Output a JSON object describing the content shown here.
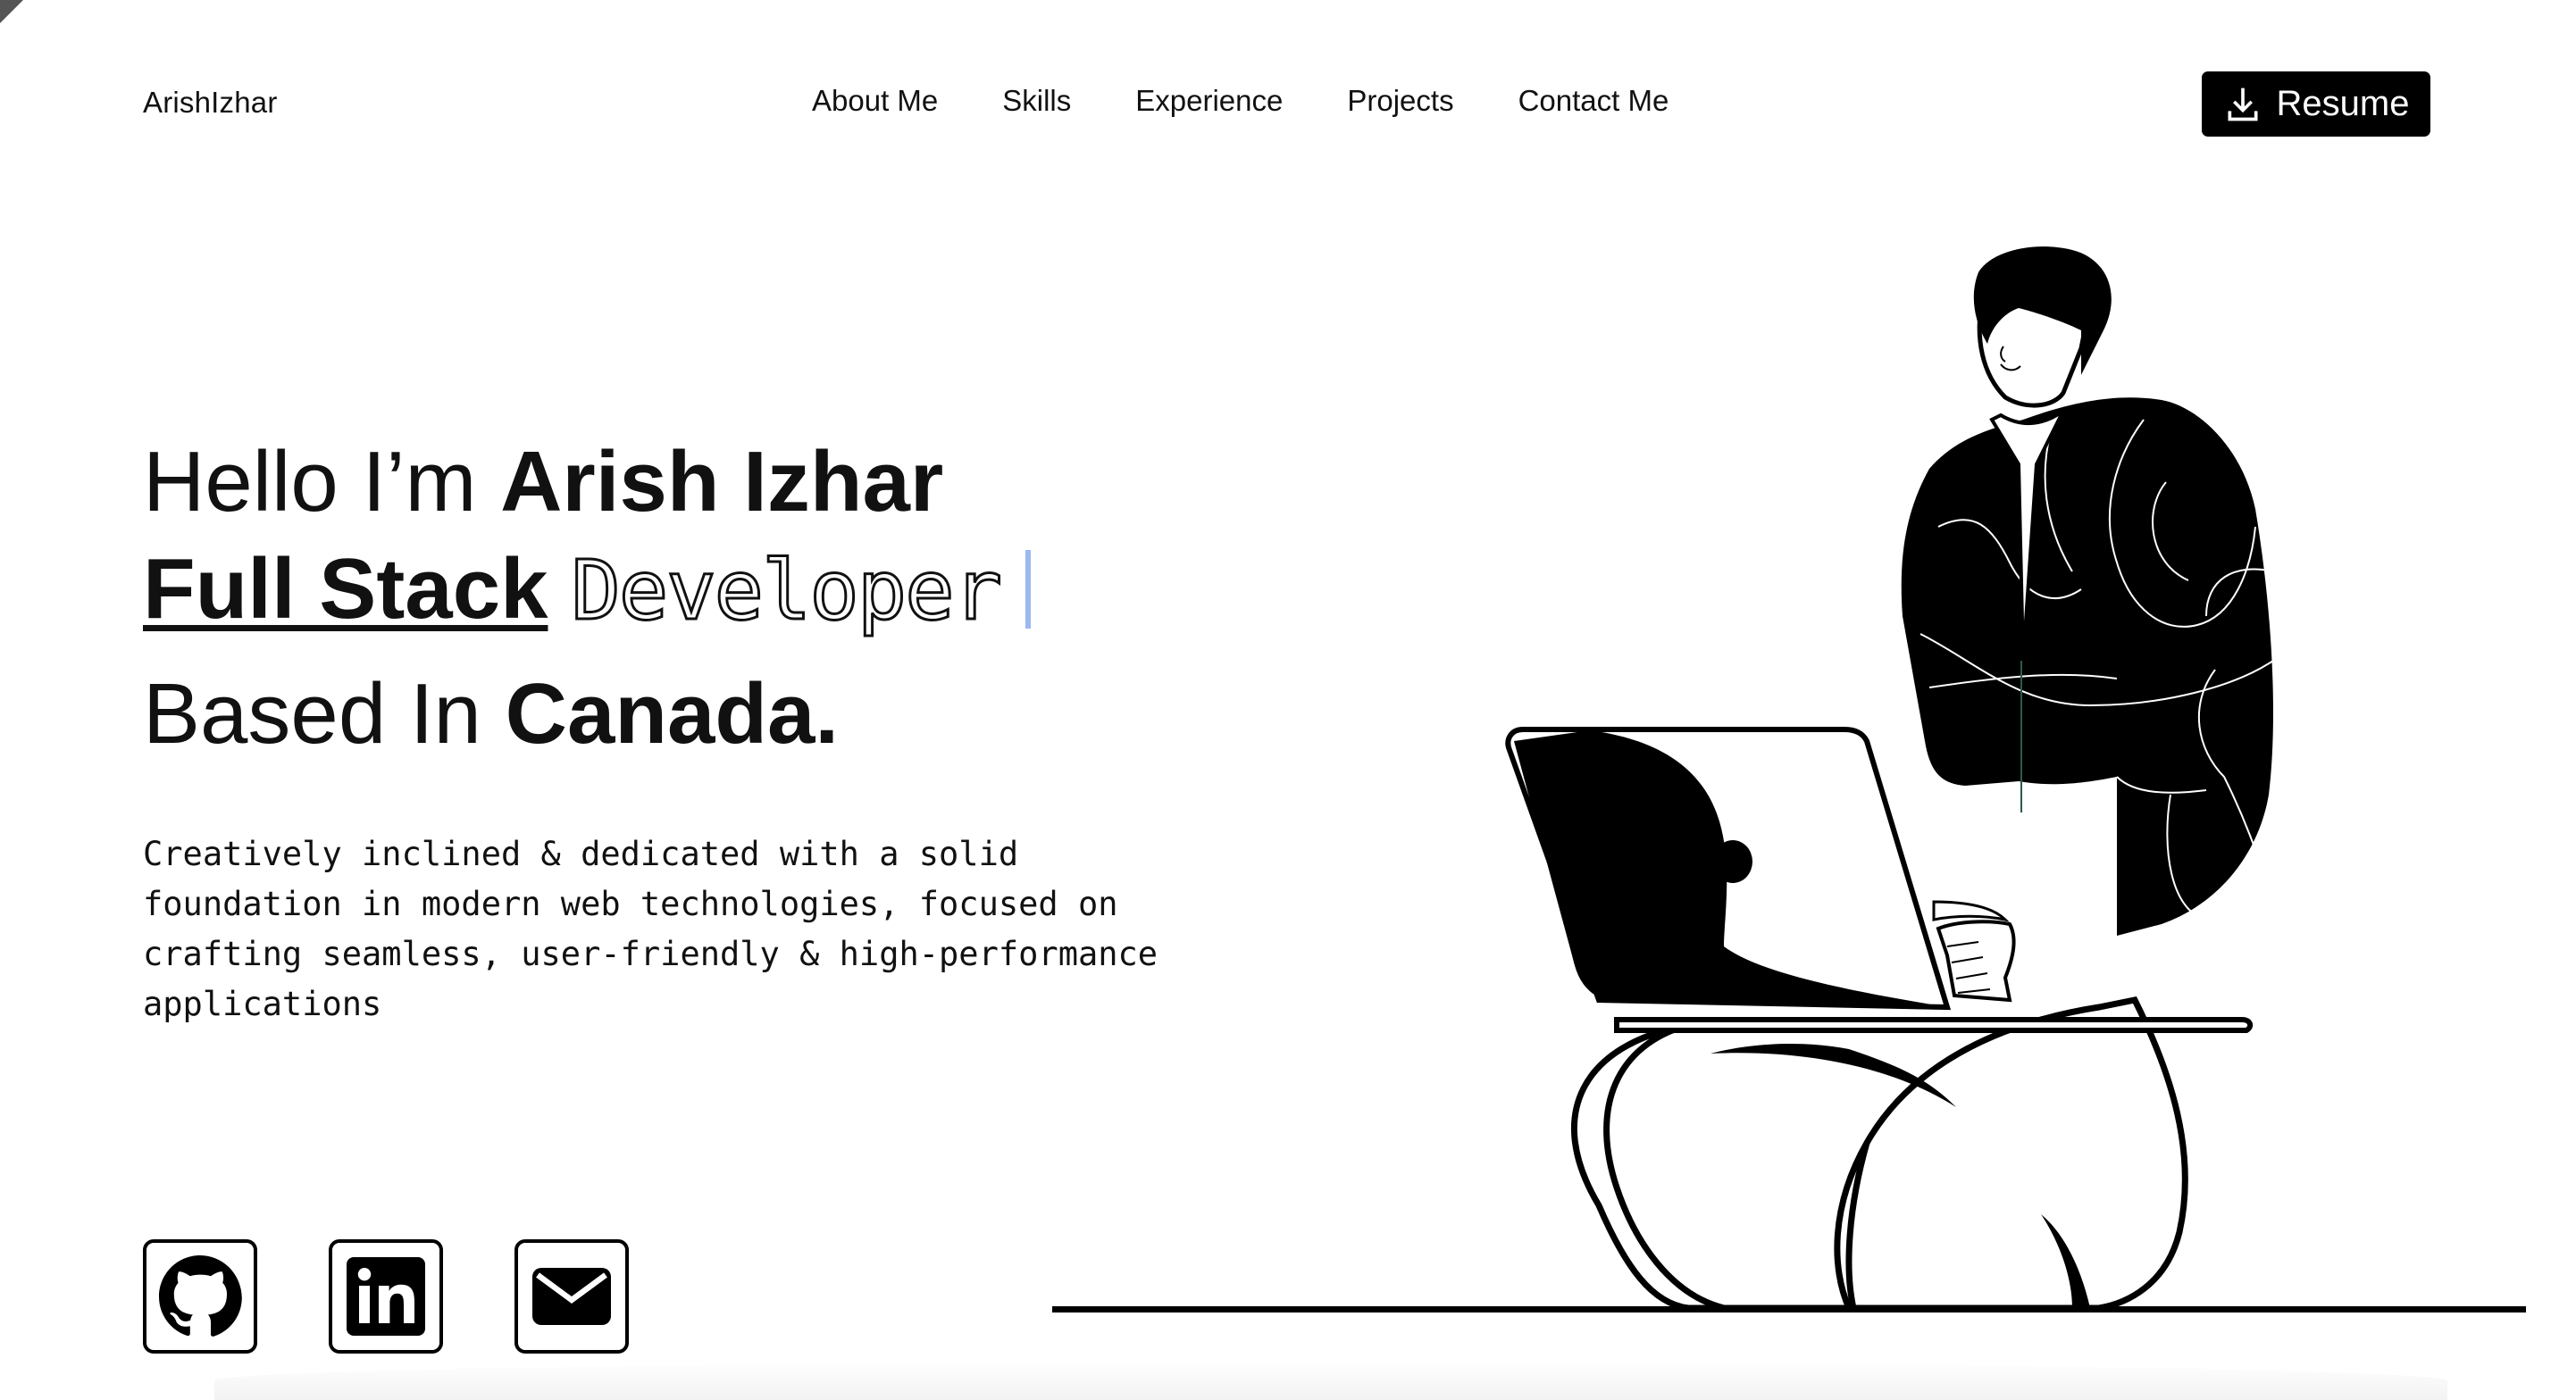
{
  "header": {
    "logo": "ArishIzhar",
    "nav": [
      {
        "label": "About Me"
      },
      {
        "label": "Skills"
      },
      {
        "label": "Experience"
      },
      {
        "label": "Projects"
      },
      {
        "label": "Contact Me"
      }
    ],
    "resume_label": "Resume",
    "resume_icon": "download-icon"
  },
  "hero": {
    "line1_prefix": "Hello I’m ",
    "line1_name": "Arish Izhar",
    "line2_bold": "Full Stack",
    "line2_outline": "Developer",
    "line3_prefix": "Based In ",
    "line3_bold": "Canada.",
    "description": "Creatively inclined & dedicated with a solid foundation in modern web technologies, focused on crafting seamless, user-friendly & high-performance applications"
  },
  "socials": [
    {
      "icon": "github-icon"
    },
    {
      "icon": "linkedin-icon"
    },
    {
      "icon": "email-icon"
    }
  ],
  "colors": {
    "background": "#ffffff",
    "text": "#111111",
    "button": "#000000",
    "caret": "#9bb8f0"
  }
}
